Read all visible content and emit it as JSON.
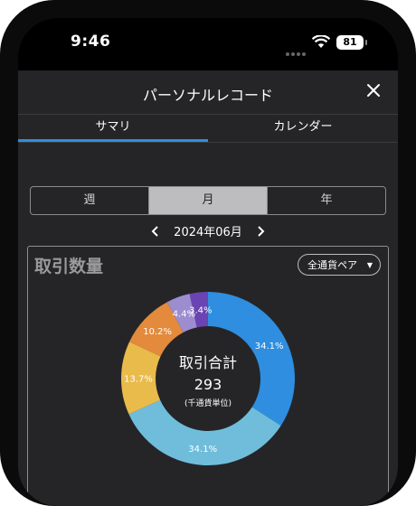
{
  "status_bar": {
    "time": "9:46",
    "battery": "81"
  },
  "header": {
    "title": "パーソナルレコード",
    "close_icon": "close-icon"
  },
  "tabs": [
    {
      "label": "サマリ",
      "active": true
    },
    {
      "label": "カレンダー",
      "active": false
    }
  ],
  "period_segments": [
    {
      "label": "週",
      "active": false
    },
    {
      "label": "月",
      "active": true
    },
    {
      "label": "年",
      "active": false
    }
  ],
  "month_nav": {
    "label": "2024年06月"
  },
  "card": {
    "title": "取引数量",
    "pair_select": "全通貨ペア",
    "center_title": "取引合計",
    "center_value": "293",
    "center_unit": "(千通貨単位)"
  },
  "chart_data": {
    "type": "pie",
    "values": [
      34.1,
      34.1,
      13.7,
      10.2,
      4.4,
      3.4
    ],
    "labels": [
      "34.1%",
      "34.1%",
      "13.7%",
      "10.2%",
      "4.4%",
      "3.4%"
    ],
    "colors": [
      "#2f8ee0",
      "#6fbddb",
      "#e9bb4a",
      "#e48a3c",
      "#9c8cd0",
      "#6a44b2"
    ],
    "total": "293"
  }
}
